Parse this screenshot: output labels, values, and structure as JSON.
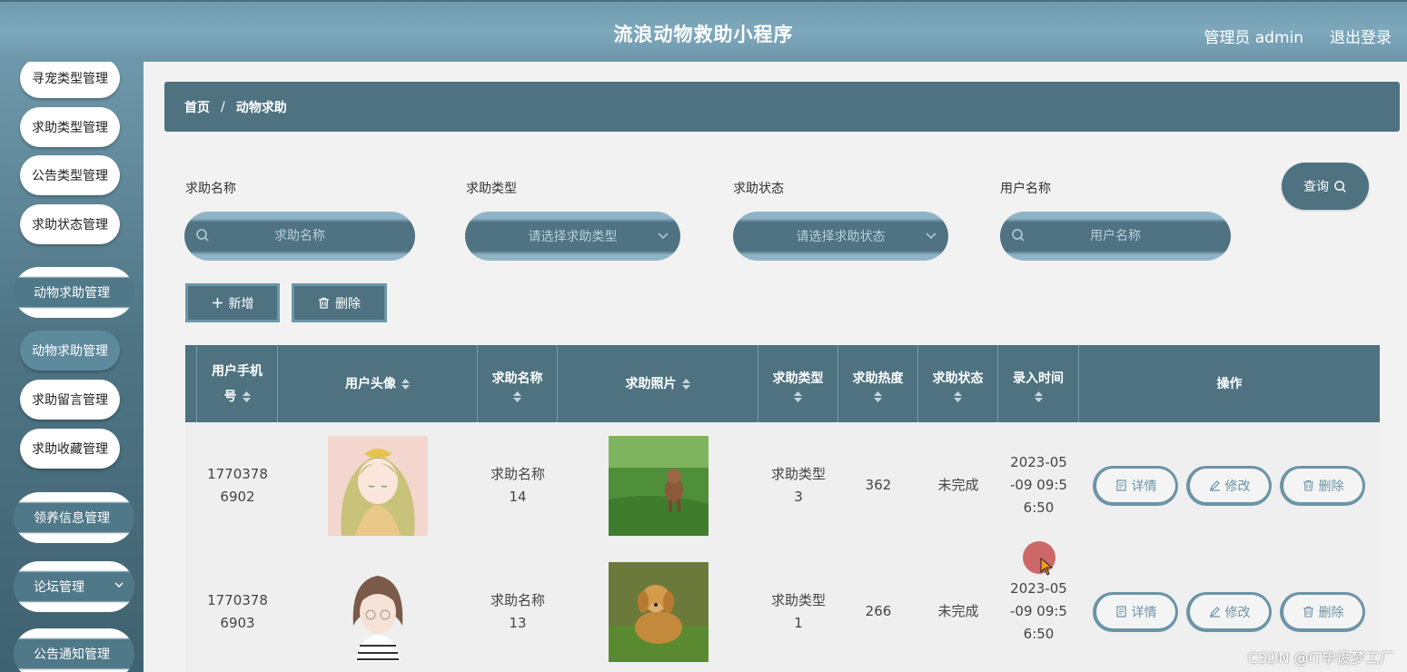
{
  "header": {
    "title": "流浪动物救助小程序",
    "admin": "管理员 admin",
    "logout": "退出登录"
  },
  "sidebar": {
    "items": [
      {
        "label": "寻宠类型管理",
        "kind": "sub",
        "active": false
      },
      {
        "label": "求助类型管理",
        "kind": "sub",
        "active": false
      },
      {
        "label": "公告类型管理",
        "kind": "sub",
        "active": false
      },
      {
        "label": "求助状态管理",
        "kind": "sub",
        "active": false
      },
      {
        "label": "动物求助管理",
        "kind": "group",
        "active": true
      },
      {
        "label": "动物求助管理",
        "kind": "sub",
        "active": true
      },
      {
        "label": "求助留言管理",
        "kind": "sub",
        "active": false
      },
      {
        "label": "求助收藏管理",
        "kind": "sub",
        "active": false
      },
      {
        "label": "领养信息管理",
        "kind": "group",
        "active": false
      },
      {
        "label": "论坛管理",
        "kind": "group",
        "active": false
      },
      {
        "label": "公告通知管理",
        "kind": "group",
        "active": false
      }
    ]
  },
  "breadcrumb": {
    "home": "首页",
    "separator": "/",
    "current": "动物求助"
  },
  "filters": {
    "name_label": "求助名称",
    "name_placeholder": "求助名称",
    "type_label": "求助类型",
    "type_placeholder": "请选择求助类型",
    "status_label": "求助状态",
    "status_placeholder": "请选择求助状态",
    "user_label": "用户名称",
    "user_placeholder": "用户名称",
    "query_button": "查询"
  },
  "actions": {
    "add": "新增",
    "delete": "删除"
  },
  "table": {
    "headers": {
      "phone_line1": "用户手机",
      "phone_line2": "号",
      "avatar": "用户头像",
      "name": "求助名称",
      "photo": "求助照片",
      "type": "求助类型",
      "heat": "求助热度",
      "status": "求助状态",
      "time": "录入时间",
      "ops": "操作"
    },
    "rows": [
      {
        "phone_a": "1770378",
        "phone_b": "6902",
        "name_a": "求助名称",
        "name_b": "14",
        "type_a": "求助类型",
        "type_b": "3",
        "heat": "362",
        "status": "未完成",
        "time_a": "2023-05",
        "time_b": "-09 09:5",
        "time_c": "6:50",
        "avatar_icon": "anime-girl-avatar",
        "photo_icon": "poodle-on-grass-photo"
      },
      {
        "phone_a": "1770378",
        "phone_b": "6903",
        "name_a": "求助名称",
        "name_b": "13",
        "type_a": "求助类型",
        "type_b": "1",
        "heat": "266",
        "status": "未完成",
        "time_a": "2023-05",
        "time_b": "-09 09:5",
        "time_c": "6:50",
        "avatar_icon": "cartoon-girl-avatar",
        "photo_icon": "golden-retriever-photo"
      }
    ],
    "row_buttons": {
      "detail": "详情",
      "edit": "修改",
      "delete": "删除"
    }
  },
  "watermark": "CSDN @IT毕设梦工厂",
  "colors": {
    "primary": "#4e7280",
    "accent": "#6b94a7",
    "header": "#7ea9bd"
  }
}
